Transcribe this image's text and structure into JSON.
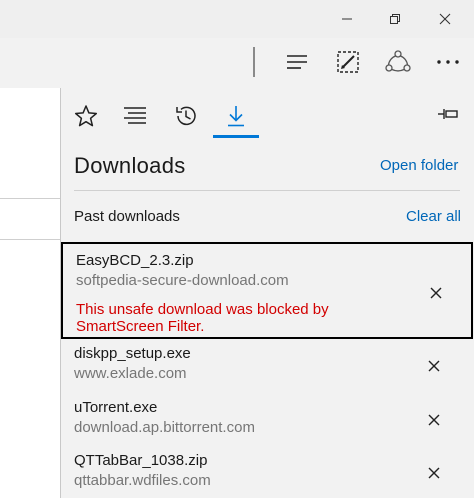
{
  "hub": {
    "title": "Downloads",
    "open_folder": "Open folder",
    "section_label": "Past downloads",
    "clear_all": "Clear all",
    "tabs": [
      {
        "icon": "favorites-star-icon"
      },
      {
        "icon": "reading-list-icon"
      },
      {
        "icon": "history-icon"
      },
      {
        "icon": "downloads-icon",
        "active": true
      }
    ],
    "accent": "#0078d7"
  },
  "downloads": [
    {
      "name": "EasyBCD_2.3.zip",
      "source": "softpedia-secure-download.com",
      "error": "This unsafe download was blocked by SmartScreen Filter.",
      "error_color": "#d20000"
    },
    {
      "name": "diskpp_setup.exe",
      "source": "www.exlade.com"
    },
    {
      "name": "uTorrent.exe",
      "source": "download.ap.bittorrent.com"
    },
    {
      "name": "QTTabBar_1038.zip",
      "source": "qttabbar.wdfiles.com"
    }
  ]
}
